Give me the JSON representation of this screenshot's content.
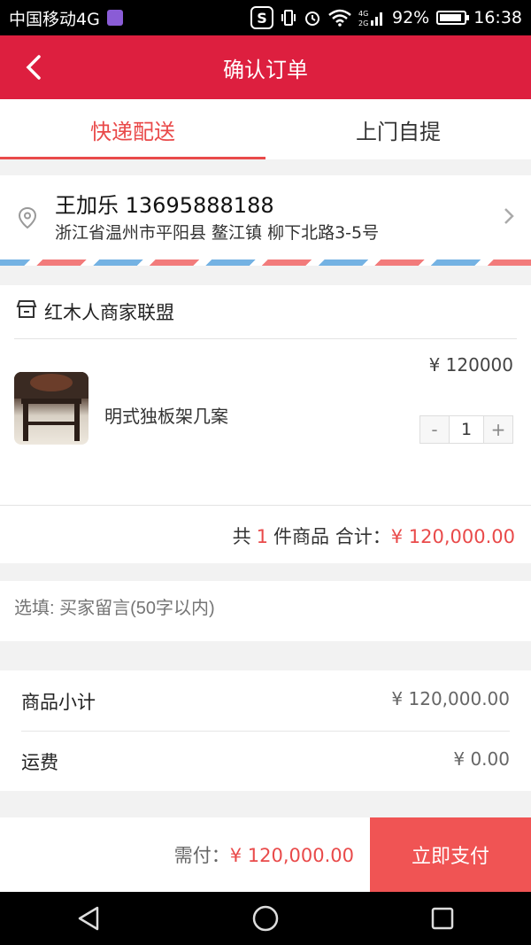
{
  "status_bar": {
    "carrier": "中国移动4G",
    "signal_label": "4G 2G",
    "battery_percent": "92%",
    "time": "16:38"
  },
  "app_bar": {
    "title": "确认订单"
  },
  "tabs": [
    {
      "label": "快递配送",
      "active": true
    },
    {
      "label": "上门自提",
      "active": false
    }
  ],
  "address": {
    "name": "王加乐",
    "phone": "13695888188",
    "detail": "浙江省温州市平阳县 鳌江镇 柳下北路3-5号"
  },
  "shop": {
    "name": "红木人商家联盟",
    "product": {
      "name": "明式独板架几案",
      "price": "¥ 120000",
      "quantity": "1",
      "minus": "-",
      "plus": "+"
    },
    "total": {
      "prefix": "共",
      "count": "1",
      "suffix": "件商品 合计：",
      "amount": "¥ 120,000.00"
    }
  },
  "message": {
    "placeholder": "选填: 买家留言(50字以内)"
  },
  "summary": [
    {
      "label": "商品小计",
      "value": "¥ 120,000.00"
    },
    {
      "label": "运费",
      "value": "¥ 0.00"
    }
  ],
  "bottom": {
    "due_label": "需付：",
    "due_amount": "¥ 120,000.00",
    "pay_button": "立即支付"
  },
  "colors": {
    "brand": "#dd1f3f",
    "accent": "#e94a4a",
    "pay": "#f05454"
  }
}
